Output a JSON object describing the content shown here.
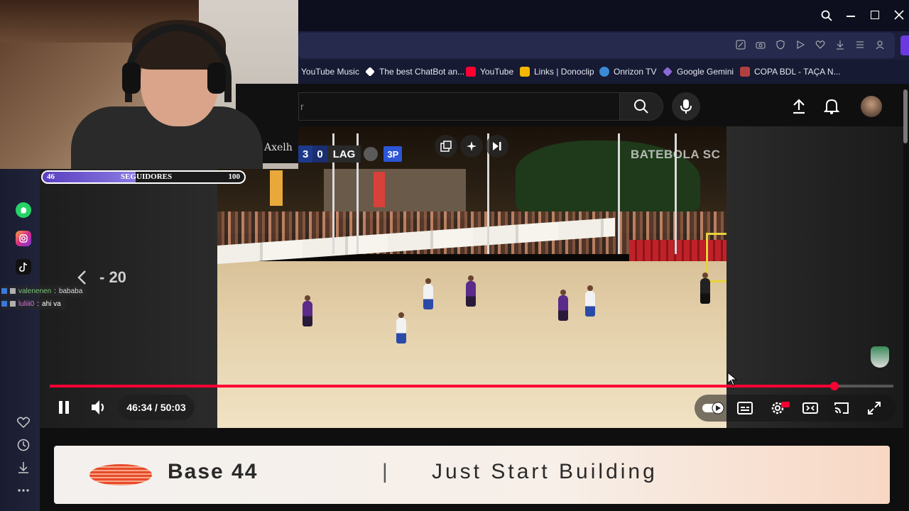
{
  "bookmarks": [
    {
      "label": "YouTube Music",
      "color": "#ff0033"
    },
    {
      "label": "The best ChatBot an...",
      "color": "#ffffff"
    },
    {
      "label": "YouTube",
      "color": "#ff0033"
    },
    {
      "label": "Links | Donoclip",
      "color": "#f5b800"
    },
    {
      "label": "Onrizon TV",
      "color": "#3a8ad6"
    },
    {
      "label": "Google Gemini",
      "color": "#8a6ad6"
    },
    {
      "label": "COPA BDL - TAÇA N...",
      "color": "#b04040"
    }
  ],
  "youtube": {
    "search_value": "r",
    "icons": [
      "search-icon",
      "microphone-icon",
      "upload-icon",
      "bell-icon",
      "avatar"
    ]
  },
  "video": {
    "scoreboard": {
      "score_home": "3",
      "score_away": "0",
      "team": "LAG",
      "period": "3P"
    },
    "watermark": "BATEBOLA SC",
    "skip_back": "- 20",
    "time": "46:34 / 50:03",
    "progress": 0.93,
    "playing": true
  },
  "stream_overlay": {
    "followers_label": "SEGUIDORES",
    "followers_current": "46",
    "followers_goal": "100",
    "cam_logo": "Axelh",
    "chat": [
      {
        "user": "valenenen",
        "message": "bababa",
        "color": "#7ac87a"
      },
      {
        "user": "luliii0",
        "message": "ahi va",
        "color": "#d878d8"
      }
    ]
  },
  "banner": {
    "brand": "Base 44",
    "separator": "|",
    "tagline": "Just Start Building"
  },
  "colors": {
    "accent": "#ff0033",
    "chrome": "#1b1f3a"
  }
}
